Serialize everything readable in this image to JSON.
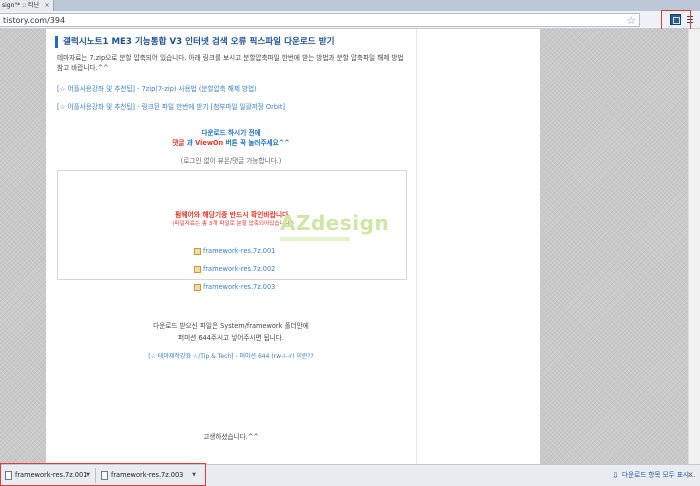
{
  "browser": {
    "tab_title": "sign\"* :: 티닌",
    "tab_close": "×",
    "url": "tistory.com/394",
    "icons": {
      "star": "star-icon",
      "extension": "extension-icon",
      "menu": "menu-icon"
    }
  },
  "post": {
    "title": "갤럭시노트1 ME3 기능통합 V3 인터넷 검색 오류 픽스파일 다운로드 받기",
    "intro": "테마자료는 7.zip으로 분할 압축되어 있습니다. 아래 링크를 보시고 분할압축파일 한번에 받는 방법과 분할 압축파일 해제 방법 참고 바랍니다.^^",
    "link1": "[☆ 어플사용강좌 및 추천팁] - 7zip(7-zip) 사용법 (분할압축 해제 방법)",
    "link2": "[☆ 어플사용강좌 및 추천팁] - 링크된 파일 한번에 받기 [첨부파일 일괄저장 Orbit]",
    "notice_line1": "다운로드 하시기 전에",
    "notice_line2_a": "댓글",
    "notice_line2_b": " 과 ",
    "notice_line2_c": "ViewOn",
    "notice_line2_d": " 버튼 꾹 눌러주세요^^",
    "notice_line3": "(로그인 없이 뷰온/댓글 가능합니다.)",
    "box_title": "펌웨어와 해당기종 반드시 확인바랍니다.",
    "box_subtitle": "(파일자료는 총 3개 파일로 분할 압축되어있습니다.)",
    "files": [
      "framework-res.7z.001",
      "framework-res.7z.002",
      "framework-res.7z.003"
    ],
    "watermark": "AZdesign",
    "after_line1": "다운로드 받으신 파일은 System/framework 폴더안에",
    "after_line2": "퍼미션 644주시고 넣어주시면 됩니다.",
    "tip_link": "[☆ 테마제작강좌 ☆/Tip & Tech] - 퍼미션 644 (rw-r--r) 이란??",
    "thanks": "고생하셨습니다.^^"
  },
  "download_bar": {
    "items": [
      "framework-res.7z.001",
      "framework-res.7z.003"
    ],
    "show_all": "다운로드 항목 모두 표시...",
    "close": "×"
  },
  "colors": {
    "accent": "#1e6fb8",
    "alert": "#e0372a",
    "highlight_box": "#e23b3b"
  }
}
